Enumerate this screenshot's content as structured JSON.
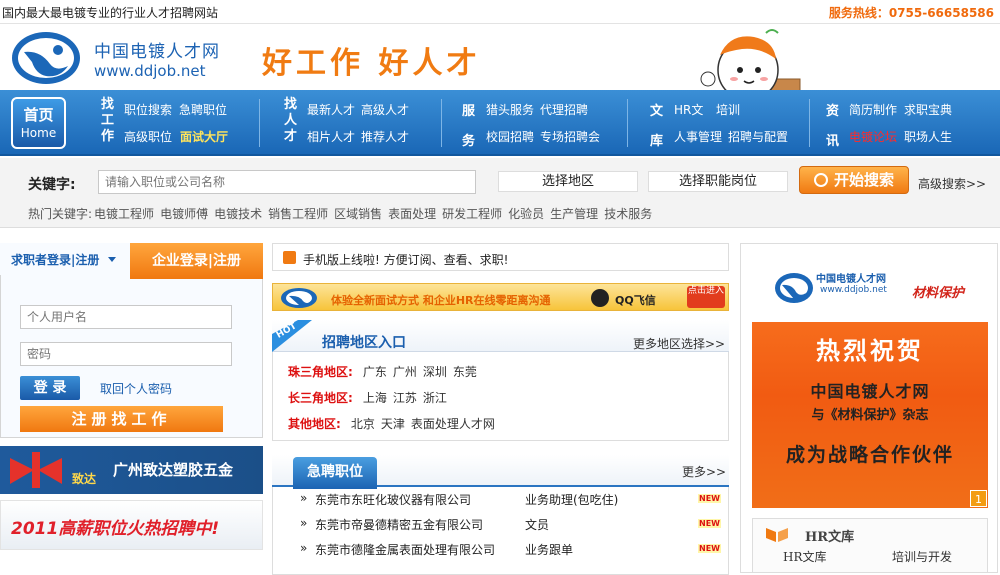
{
  "topbar": {
    "tagline": "国内最大最电镀专业的行业人才招聘网站",
    "hotline": "服务热线：0755-66658586"
  },
  "brand": {
    "name": "中国电镀人才网",
    "domain": "www.ddjob.net",
    "slogan": "好工作 好人才"
  },
  "nav": {
    "home": {
      "label_cn": "首页",
      "label_en": "Home"
    },
    "groups": [
      {
        "category": "找工作",
        "links": [
          "职位搜索",
          "急聘职位",
          "高级职位",
          "面试大厅"
        ]
      },
      {
        "category": "找人才",
        "links": [
          "最新人才",
          "高级人才",
          "相片人才",
          "推荐人才"
        ]
      },
      {
        "category": "服务",
        "links": [
          "猎头服务",
          "代理招聘",
          "校园招聘",
          "专场招聘会"
        ]
      },
      {
        "category": "文库",
        "links": [
          "HR文",
          "培训",
          "人事管理",
          "招聘与配置"
        ]
      },
      {
        "category": "资讯",
        "links": [
          "简历制作",
          "求职宝典",
          "电镀论坛",
          "职场人生"
        ]
      }
    ]
  },
  "search": {
    "label": "关键字:",
    "placeholder": "请输入职位或公司名称",
    "area_select": "选择地区",
    "function_select": "选择职能岗位",
    "button": "开始搜索",
    "advanced": "高级搜索>>",
    "hot_label": "热门关键字:",
    "hot_keywords": [
      "电镀工程师",
      "电镀师傅",
      "电镀技术",
      "销售工程师",
      "区域销售",
      "表面处理",
      "研发工程师",
      "化验员",
      "生产管理",
      "技术服务"
    ]
  },
  "login": {
    "tab_personal": "求职者登录|注册",
    "tab_company": "企业登录|注册",
    "username_placeholder": "个人用户名",
    "password_placeholder": "密码",
    "login_button": "登 录",
    "forgot": "取回个人密码",
    "register_button": "注册找工作"
  },
  "ads": {
    "ad1_text": "广州致达塑胶五金",
    "ad1_logo_text": "致达",
    "ad2_text": "2011高薪职位火热招聘中!",
    "banner_text": "体验全新面试方式 和企业HR在线零距离沟通",
    "banner_qq": "QQ飞信",
    "banner_click": "点击进入"
  },
  "notice": {
    "text": "手机版上线啦! 方便订阅、查看、求职!"
  },
  "regions": {
    "tag": "HOT",
    "title": "招聘地区入口",
    "more": "更多地区选择>>",
    "rows": [
      {
        "label": "珠三角地区:",
        "items": [
          "广东",
          "广州",
          "深圳",
          "东莞"
        ]
      },
      {
        "label": "长三角地区:",
        "items": [
          "上海",
          "江苏",
          "浙江"
        ]
      },
      {
        "label": "其他地区:",
        "items": [
          "北京",
          "天津",
          "表面处理人才网"
        ]
      }
    ]
  },
  "urgent_jobs": {
    "title": "急聘职位",
    "more": "更多>>",
    "new_badge": "NEW",
    "rows": [
      {
        "company": "东莞市东旺化玻仪器有限公司",
        "position": "业务助理(包吃住)"
      },
      {
        "company": "东莞市帝曼德精密五金有限公司",
        "position": "文员"
      },
      {
        "company": "东莞市德隆金属表面处理有限公司",
        "position": "业务跟单"
      }
    ]
  },
  "right_ad": {
    "brand": "中国电镀人才网",
    "domain": "www.ddjob.net",
    "partner": "材料保护",
    "headline": "热烈祝贺",
    "line1": "中国电镀人才网",
    "line2": "与《材料保护》杂志",
    "line3": "成为战略合作伙伴",
    "page": "1"
  },
  "hr_library": {
    "title": "HR文库",
    "links": [
      "HR文库",
      "培训与开发"
    ]
  }
}
